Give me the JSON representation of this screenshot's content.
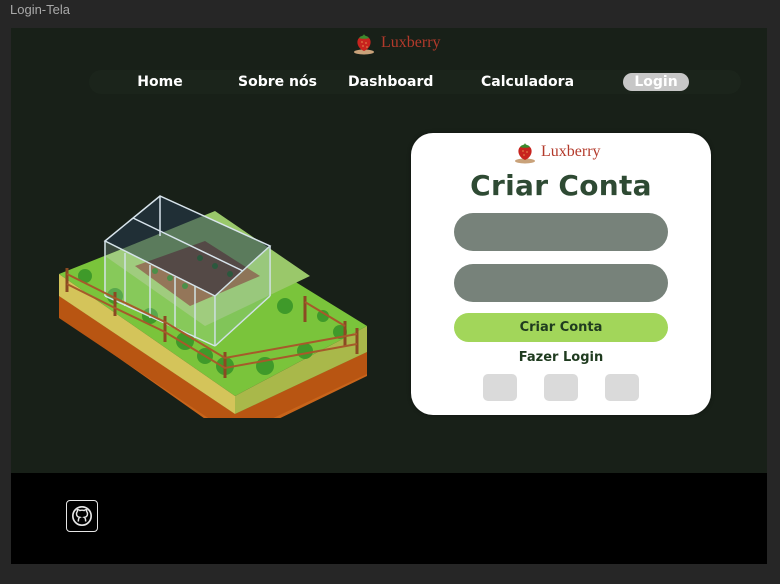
{
  "window": {
    "title": "Login-Tela"
  },
  "brand": {
    "name": "Luxberry",
    "logo_icon": "strawberry-icon",
    "color": "#b33a2b"
  },
  "nav": {
    "items": [
      {
        "label": "Home"
      },
      {
        "label": "Sobre nós"
      },
      {
        "label": "Dashboard"
      },
      {
        "label": "Calculadora"
      },
      {
        "label": "Login",
        "active": true
      }
    ]
  },
  "hero": {
    "image": "greenhouse-illustration"
  },
  "card": {
    "brand": "Luxberry",
    "title": "Criar Conta",
    "fields": [
      {
        "value": "",
        "placeholder": ""
      },
      {
        "value": "",
        "placeholder": ""
      }
    ],
    "primary_button": "Criar Conta",
    "secondary_link": "Fazer Login",
    "social_buttons": [
      "social-button",
      "social-button",
      "social-button"
    ]
  },
  "footer": {
    "icon": "github-icon"
  },
  "colors": {
    "background": "#182018",
    "card": "#ffffff",
    "title": "#2e4a33",
    "field": "#77827a",
    "primary_button": "#a2d65a",
    "footer": "#000000",
    "nav_active": "#c7c7c7"
  }
}
